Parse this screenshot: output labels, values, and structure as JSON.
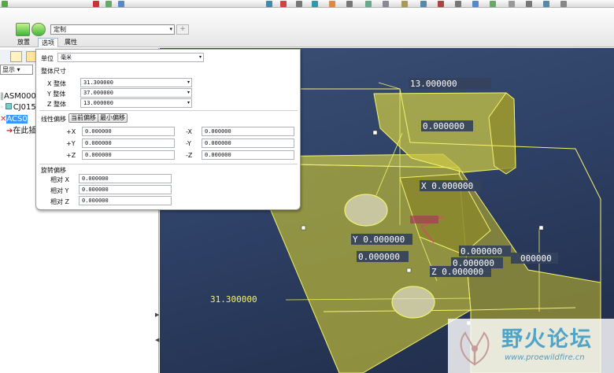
{
  "ribbon": {
    "template_value": "定制",
    "tabs": [
      "放置",
      "选项",
      "属性"
    ]
  },
  "tree": {
    "show_label": "显示",
    "items": [
      "ASM000",
      "CJ015",
      "ACS0",
      "在此插"
    ]
  },
  "options": {
    "unit_label": "单位",
    "unit_value": "毫米",
    "overall_title": "整体尺寸",
    "overall_rows": [
      {
        "label": "X 整体",
        "value": "31.300000"
      },
      {
        "label": "Y 整体",
        "value": "37.000000"
      },
      {
        "label": "Z 整体",
        "value": "13.000000"
      }
    ],
    "offset_title": "线性偏移",
    "current_offset_btn": "当前偏移",
    "min_offset_btn": "最小偏移",
    "offset_left": [
      {
        "label": "+X",
        "value": "0.000000"
      },
      {
        "label": "+Y",
        "value": "0.000000"
      },
      {
        "label": "+Z",
        "value": "0.000000"
      }
    ],
    "offset_right": [
      {
        "label": "-X",
        "value": "0.000000"
      },
      {
        "label": "-Y",
        "value": "0.000000"
      },
      {
        "label": "-Z",
        "value": "0.000000"
      }
    ],
    "rotation_title": "旋转偏移",
    "rotation_rows": [
      {
        "label": "相对 X",
        "value": "0.000000"
      },
      {
        "label": "相对 Y",
        "value": "0.000000"
      },
      {
        "label": "相对 Z",
        "value": "0.000000"
      }
    ]
  },
  "viewport": {
    "dims": {
      "top": "13.000000",
      "top_offset": "0.000000",
      "x": "X 0.000000",
      "y": "Y 0.000000",
      "y_offset": "0.000000",
      "mid_a": "0.000000",
      "mid_b": "0.000000",
      "mid_c": "000000",
      "z": "Z 0.000000",
      "left": "31.300000"
    }
  },
  "watermark": {
    "title": "野火论坛",
    "url": "www.proewildfire.cn"
  },
  "colors": {
    "model_fill": "#d6d34a",
    "model_edge": "#f4f26c",
    "selection": "#3399ff",
    "viewport_bg": "#2f4268"
  }
}
